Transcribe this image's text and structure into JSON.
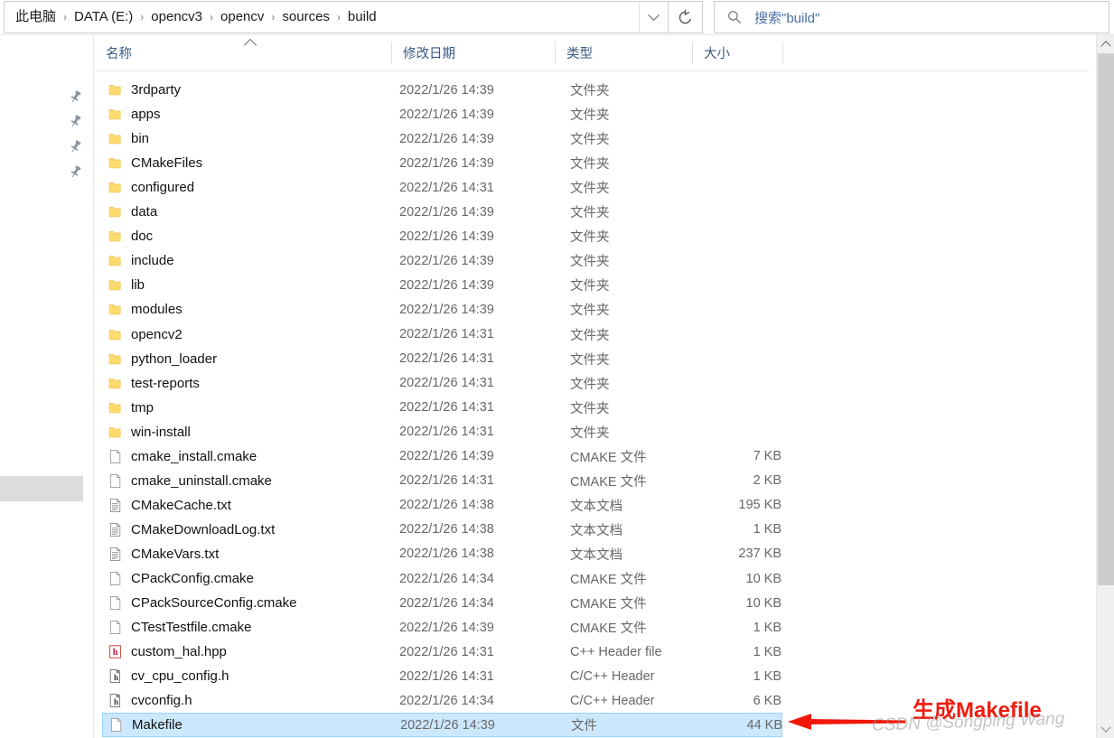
{
  "addressbar": {
    "breadcrumbs": [
      "此电脑",
      "DATA (E:)",
      "opencv3",
      "opencv",
      "sources",
      "build"
    ],
    "separator": "›",
    "dropdown_icon": "chevron-down-icon",
    "refresh_icon": "refresh-icon"
  },
  "search": {
    "icon": "search-icon",
    "placeholder": "搜索\"build\""
  },
  "navpane": {
    "pinned_count": 4,
    "pin_icon": "pin-icon"
  },
  "columns": [
    {
      "label": "名称",
      "key": "name"
    },
    {
      "label": "修改日期",
      "key": "date"
    },
    {
      "label": "类型",
      "key": "type"
    },
    {
      "label": "大小",
      "key": "size"
    }
  ],
  "sort": {
    "column": "名称",
    "direction": "ascending",
    "icon": "caret-up-icon"
  },
  "files": [
    {
      "name": "3rdparty",
      "date": "2022/1/26 14:39",
      "type": "文件夹",
      "size": "",
      "icon": "folder-icon",
      "selected": false
    },
    {
      "name": "apps",
      "date": "2022/1/26 14:39",
      "type": "文件夹",
      "size": "",
      "icon": "folder-icon",
      "selected": false
    },
    {
      "name": "bin",
      "date": "2022/1/26 14:39",
      "type": "文件夹",
      "size": "",
      "icon": "folder-icon",
      "selected": false
    },
    {
      "name": "CMakeFiles",
      "date": "2022/1/26 14:39",
      "type": "文件夹",
      "size": "",
      "icon": "folder-icon",
      "selected": false
    },
    {
      "name": "configured",
      "date": "2022/1/26 14:31",
      "type": "文件夹",
      "size": "",
      "icon": "folder-icon",
      "selected": false
    },
    {
      "name": "data",
      "date": "2022/1/26 14:39",
      "type": "文件夹",
      "size": "",
      "icon": "folder-icon",
      "selected": false
    },
    {
      "name": "doc",
      "date": "2022/1/26 14:39",
      "type": "文件夹",
      "size": "",
      "icon": "folder-icon",
      "selected": false
    },
    {
      "name": "include",
      "date": "2022/1/26 14:39",
      "type": "文件夹",
      "size": "",
      "icon": "folder-icon",
      "selected": false
    },
    {
      "name": "lib",
      "date": "2022/1/26 14:39",
      "type": "文件夹",
      "size": "",
      "icon": "folder-icon",
      "selected": false
    },
    {
      "name": "modules",
      "date": "2022/1/26 14:39",
      "type": "文件夹",
      "size": "",
      "icon": "folder-icon",
      "selected": false
    },
    {
      "name": "opencv2",
      "date": "2022/1/26 14:31",
      "type": "文件夹",
      "size": "",
      "icon": "folder-icon",
      "selected": false
    },
    {
      "name": "python_loader",
      "date": "2022/1/26 14:31",
      "type": "文件夹",
      "size": "",
      "icon": "folder-icon",
      "selected": false
    },
    {
      "name": "test-reports",
      "date": "2022/1/26 14:31",
      "type": "文件夹",
      "size": "",
      "icon": "folder-icon",
      "selected": false
    },
    {
      "name": "tmp",
      "date": "2022/1/26 14:31",
      "type": "文件夹",
      "size": "",
      "icon": "folder-icon",
      "selected": false
    },
    {
      "name": "win-install",
      "date": "2022/1/26 14:31",
      "type": "文件夹",
      "size": "",
      "icon": "folder-icon",
      "selected": false
    },
    {
      "name": "cmake_install.cmake",
      "date": "2022/1/26 14:39",
      "type": "CMAKE 文件",
      "size": "7 KB",
      "icon": "blank-file-icon",
      "selected": false
    },
    {
      "name": "cmake_uninstall.cmake",
      "date": "2022/1/26 14:31",
      "type": "CMAKE 文件",
      "size": "2 KB",
      "icon": "blank-file-icon",
      "selected": false
    },
    {
      "name": "CMakeCache.txt",
      "date": "2022/1/26 14:38",
      "type": "文本文档",
      "size": "195 KB",
      "icon": "text-file-icon",
      "selected": false
    },
    {
      "name": "CMakeDownloadLog.txt",
      "date": "2022/1/26 14:38",
      "type": "文本文档",
      "size": "1 KB",
      "icon": "text-file-icon",
      "selected": false
    },
    {
      "name": "CMakeVars.txt",
      "date": "2022/1/26 14:38",
      "type": "文本文档",
      "size": "237 KB",
      "icon": "text-file-icon",
      "selected": false
    },
    {
      "name": "CPackConfig.cmake",
      "date": "2022/1/26 14:34",
      "type": "CMAKE 文件",
      "size": "10 KB",
      "icon": "blank-file-icon",
      "selected": false
    },
    {
      "name": "CPackSourceConfig.cmake",
      "date": "2022/1/26 14:34",
      "type": "CMAKE 文件",
      "size": "10 KB",
      "icon": "blank-file-icon",
      "selected": false
    },
    {
      "name": "CTestTestfile.cmake",
      "date": "2022/1/26 14:39",
      "type": "CMAKE 文件",
      "size": "1 KB",
      "icon": "blank-file-icon",
      "selected": false
    },
    {
      "name": "custom_hal.hpp",
      "date": "2022/1/26 14:31",
      "type": "C++ Header file",
      "size": "1 KB",
      "icon": "hpp-header-icon",
      "selected": false
    },
    {
      "name": "cv_cpu_config.h",
      "date": "2022/1/26 14:31",
      "type": "C/C++ Header",
      "size": "1 KB",
      "icon": "h-header-icon",
      "selected": false
    },
    {
      "name": "cvconfig.h",
      "date": "2022/1/26 14:34",
      "type": "C/C++ Header",
      "size": "6 KB",
      "icon": "h-header-icon",
      "selected": false
    },
    {
      "name": "Makefile",
      "date": "2022/1/26 14:39",
      "type": "文件",
      "size": "44 KB",
      "icon": "blank-file-icon",
      "selected": true
    }
  ],
  "annotation": {
    "text": "生成Makefile",
    "color": "#f01b0e",
    "arrow_icon": "left-arrow-annotation",
    "watermark": "CSDN @Songping Wang"
  },
  "scrollbar": {
    "up_icon": "caret-up-icon",
    "down_icon": "caret-down-icon"
  },
  "colors": {
    "selection": "#cce8ff",
    "selection_border": "#99d1ff",
    "folder": "#ffd playwright"
  }
}
